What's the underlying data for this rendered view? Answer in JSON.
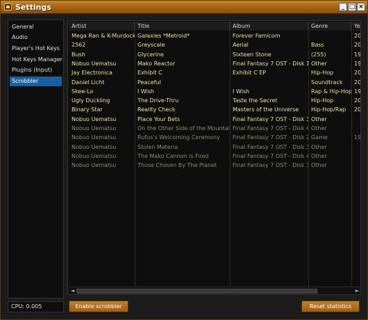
{
  "window": {
    "title": "Settings",
    "min_label": "_",
    "max_label": "□",
    "close_label": "×"
  },
  "sidebar": {
    "items": [
      {
        "label": "General"
      },
      {
        "label": "Audio"
      },
      {
        "label": "Player's Hot Keys"
      },
      {
        "label": "Hot Keys Manager"
      },
      {
        "label": "Plugins (Input)"
      },
      {
        "label": "Scrobbler",
        "active": true
      }
    ]
  },
  "status": {
    "cpu": "CPU: 0.005"
  },
  "table": {
    "columns": [
      "Artist",
      "Title",
      "Album",
      "Genre",
      "Ye"
    ],
    "rows": [
      {
        "artist": "Mega Ran & K-Murdock",
        "title": "Galaxies *Metroid*",
        "album": "Forever Famicom",
        "genre": "",
        "year": "20",
        "style": "bright"
      },
      {
        "artist": "2562",
        "title": "Greyscale",
        "album": "Aerial",
        "genre": "Bass",
        "year": "20",
        "style": "bright"
      },
      {
        "artist": "Bush",
        "title": "Glycerine",
        "album": "Sixteen Stone",
        "genre": "(255)",
        "year": "19",
        "style": "bright"
      },
      {
        "artist": "Nobuo Uematsu",
        "title": "Mako Reactor",
        "album": "Final Fantasy 7 OST - Disk 1",
        "genre": "Other",
        "year": "19",
        "style": "bright"
      },
      {
        "artist": "Jay Electronica",
        "title": "Exhibit C",
        "album": "Exhibit C EP",
        "genre": "Hip-Hop",
        "year": "20",
        "style": "bright"
      },
      {
        "artist": "Daniel Licht",
        "title": "Peaceful",
        "album": "",
        "genre": "Soundtrack",
        "year": "20",
        "style": "bright"
      },
      {
        "artist": "Skee-Lo",
        "title": "I Wish",
        "album": "I Wish",
        "genre": "Rap & Hip-Hop",
        "year": "19",
        "style": "bright"
      },
      {
        "artist": "Ugly Duckling",
        "title": "The Drive-Thru",
        "album": "Taste the Secret",
        "genre": "Hip-Hop",
        "year": "20",
        "style": "bright"
      },
      {
        "artist": "Binary Star",
        "title": "Reality Check",
        "album": "Masters of the Universe",
        "genre": "Hip-Hop/Rap",
        "year": "20",
        "style": "bright"
      },
      {
        "artist": "Nobuo Uematsu",
        "title": "Place Your Bets",
        "album": "Final Fantasy 7 OST - Disk 3",
        "genre": "Other",
        "year": "",
        "style": "bright"
      },
      {
        "artist": "Nobuo Uematsu",
        "title": "On the Other Side of the Mountain",
        "album": "Final Fantasy 7 OST - Disk 4",
        "genre": "Other",
        "year": "",
        "style": "dim"
      },
      {
        "artist": "Nobuo Uematsu",
        "title": "Rufus's Welcoming Ceremony",
        "album": "Final Fantasy 7 OST - Disk 2",
        "genre": "Game",
        "year": "19",
        "style": "dim"
      },
      {
        "artist": "Nobuo Uematsu",
        "title": "Stolen Materia",
        "album": "Final Fantasy 7 OST - Disk 3",
        "genre": "Other",
        "year": "",
        "style": "dim"
      },
      {
        "artist": "Nobuo Uematsu",
        "title": "The Mako Cannon is Fired",
        "album": "Final Fantasy 7 OST - Disk 4",
        "genre": "Other",
        "year": "",
        "style": "dim"
      },
      {
        "artist": "Nobuo Uematsu",
        "title": "Those Chosen By The Planet",
        "album": "Final Fantasy 7 OST - Disk 3",
        "genre": "Other",
        "year": "",
        "style": "dim"
      }
    ]
  },
  "scrollbar": {
    "left_icon": "◄",
    "right_icon": "►"
  },
  "buttons": {
    "enable": "Enable scrobbler",
    "reset": "Reset statistics"
  },
  "colors": {
    "accent": "#1a5f9e",
    "bright_text": "#e8e39a",
    "dim_text": "#8c8c6a",
    "button": "#b06f22"
  }
}
